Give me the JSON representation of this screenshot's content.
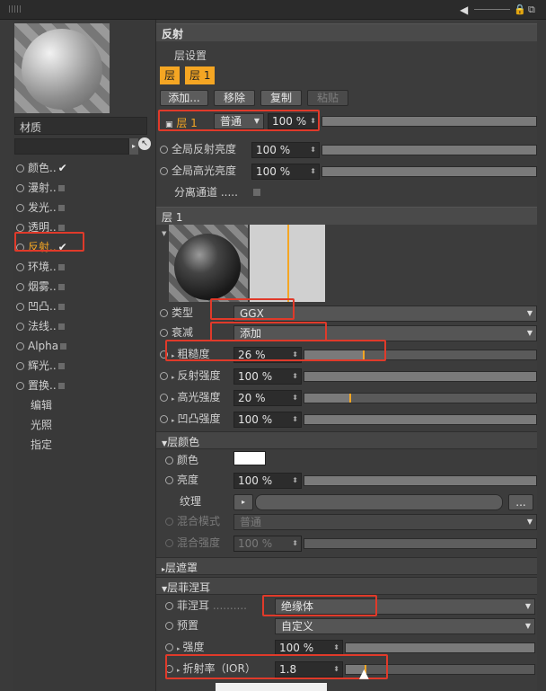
{
  "left": {
    "material_label": "材质",
    "channels": [
      {
        "label": "颜色",
        "suffix": "..",
        "checked": true
      },
      {
        "label": "漫射",
        "suffix": "..",
        "checked": false
      },
      {
        "label": "发光",
        "suffix": "..",
        "checked": false
      },
      {
        "label": "透明",
        "suffix": "..",
        "checked": false
      },
      {
        "label": "反射",
        "suffix": "..",
        "checked": true
      },
      {
        "label": "环境",
        "suffix": "..",
        "checked": false
      },
      {
        "label": "烟雾",
        "suffix": "..",
        "checked": false
      },
      {
        "label": "凹凸",
        "suffix": "..",
        "checked": false
      },
      {
        "label": "法线",
        "suffix": "..",
        "checked": false
      },
      {
        "label": "Alpha",
        "suffix": "",
        "checked": false
      },
      {
        "label": "辉光",
        "suffix": "..",
        "checked": false
      },
      {
        "label": "置换",
        "suffix": "..",
        "checked": false
      }
    ],
    "extras": [
      "编辑",
      "光照",
      "指定"
    ]
  },
  "reflect": {
    "title": "反射",
    "layer_settings": "层设置",
    "layer_tabs": [
      "层",
      "层 1"
    ],
    "buttons": {
      "add": "添加...",
      "remove": "移除",
      "copy": "复制",
      "paste": "粘贴"
    },
    "layer_row": {
      "name": "层 1",
      "mode": "普通",
      "value": "100 %"
    },
    "global_reflect": {
      "label": "全局反射亮度",
      "value": "100 %"
    },
    "global_spec": {
      "label": "全局高光亮度",
      "value": "100 %"
    },
    "separate": {
      "label": "分离通道 ....."
    }
  },
  "layer1": {
    "title": "层 1",
    "type": {
      "label": "类型",
      "value": "GGX"
    },
    "attenuation": {
      "label": "衰减",
      "value": "添加"
    },
    "roughness": {
      "label": "粗糙度",
      "value": "26 %",
      "level": 0.26
    },
    "reflect_strength": {
      "label": "反射强度",
      "value": "100 %",
      "level": 1.0
    },
    "spec_strength": {
      "label": "高光强度",
      "value": "20 %",
      "level": 0.2
    },
    "bump_strength": {
      "label": "凹凸强度",
      "value": "100 %",
      "level": 1.0
    }
  },
  "layer_color": {
    "title": "层颜色",
    "color": {
      "label": "颜色"
    },
    "brightness": {
      "label": "亮度",
      "value": "100 %"
    },
    "texture": {
      "label": "纹理",
      "button": "..."
    },
    "blend_mode": {
      "label": "混合模式",
      "value": "普通"
    },
    "blend_strength": {
      "label": "混合强度",
      "value": "100 %"
    }
  },
  "layer_mask": {
    "title": "层遮罩"
  },
  "fresnel": {
    "title": "层菲涅耳",
    "fresnel": {
      "label": "菲涅耳",
      "value": "绝缘体"
    },
    "preset": {
      "label": "预置",
      "value": "自定义"
    },
    "strength": {
      "label": "强度",
      "value": "100 %"
    },
    "ior": {
      "label": "折射率（IOR）",
      "value": "1.8"
    }
  },
  "colors": {
    "accent": "#f5a623",
    "highlight": "#e03a2a"
  }
}
